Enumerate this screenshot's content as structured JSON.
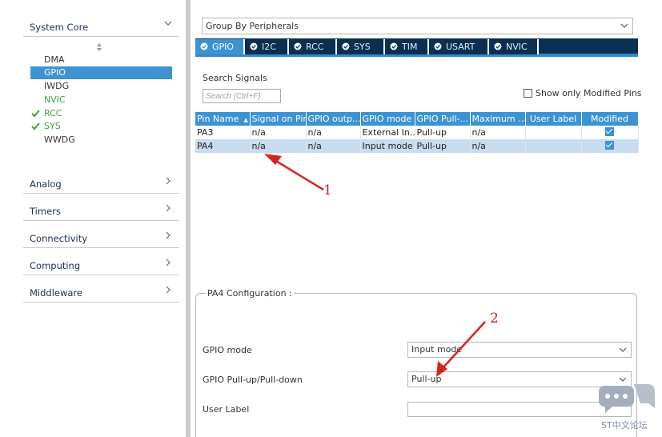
{
  "left_panel": {
    "categories": [
      {
        "label": "System Core",
        "expanded": true
      },
      {
        "label": "Analog"
      },
      {
        "label": "Timers"
      },
      {
        "label": "Connectivity"
      },
      {
        "label": "Computing"
      },
      {
        "label": "Middleware"
      }
    ],
    "system_core_items": [
      {
        "label": "DMA",
        "checked": false,
        "selected": false,
        "color": "default"
      },
      {
        "label": "GPIO",
        "checked": false,
        "selected": true,
        "color": "default"
      },
      {
        "label": "IWDG",
        "checked": false,
        "selected": false,
        "color": "default"
      },
      {
        "label": "NVIC",
        "checked": false,
        "selected": false,
        "color": "green"
      },
      {
        "label": "RCC",
        "checked": true,
        "selected": false,
        "color": "green"
      },
      {
        "label": "SYS",
        "checked": true,
        "selected": false,
        "color": "green"
      },
      {
        "label": "WWDG",
        "checked": false,
        "selected": false,
        "color": "default"
      }
    ]
  },
  "group_by": {
    "value": "Group By Peripherals"
  },
  "tabs": [
    {
      "label": "GPIO",
      "active": true
    },
    {
      "label": "I2C",
      "active": false
    },
    {
      "label": "RCC",
      "active": false
    },
    {
      "label": "SYS",
      "active": false
    },
    {
      "label": "TIM",
      "active": false
    },
    {
      "label": "USART",
      "active": false
    },
    {
      "label": "NVIC",
      "active": false
    }
  ],
  "search": {
    "label": "Search Signals",
    "placeholder": "Search (Ctrl+F)"
  },
  "show_modified": {
    "label": "Show only Modified Pins",
    "checked": false
  },
  "signals_table": {
    "columns": [
      "Pin Name",
      "Signal on Pin",
      "GPIO outp...",
      "GPIO mode",
      "GPIO Pull-...",
      "Maximum ...",
      "User Label",
      "Modified"
    ],
    "rows": [
      {
        "cells": [
          "PA3",
          "n/a",
          "n/a",
          "External In...",
          "Pull-up",
          "n/a",
          ""
        ],
        "modified": true,
        "selected": false
      },
      {
        "cells": [
          "PA4",
          "n/a",
          "n/a",
          "Input mode",
          "Pull-up",
          "n/a",
          ""
        ],
        "modified": true,
        "selected": true
      }
    ]
  },
  "config": {
    "title": "PA4 Configuration :",
    "fields": [
      {
        "label": "GPIO mode",
        "value": "Input mode",
        "type": "select"
      },
      {
        "label": "GPIO Pull-up/Pull-down",
        "value": "Pull-up",
        "type": "select"
      },
      {
        "label": "User Label",
        "value": "",
        "type": "text"
      }
    ]
  },
  "annotations": [
    "1",
    "2"
  ],
  "watermark": "ST中文论坛",
  "colors": {
    "accent": "#3d93d1",
    "tabbar": "#0a2f52",
    "selected_row": "#c7dbf1",
    "enabled_green": "#3aa335",
    "annotation_red": "#c0231c"
  }
}
